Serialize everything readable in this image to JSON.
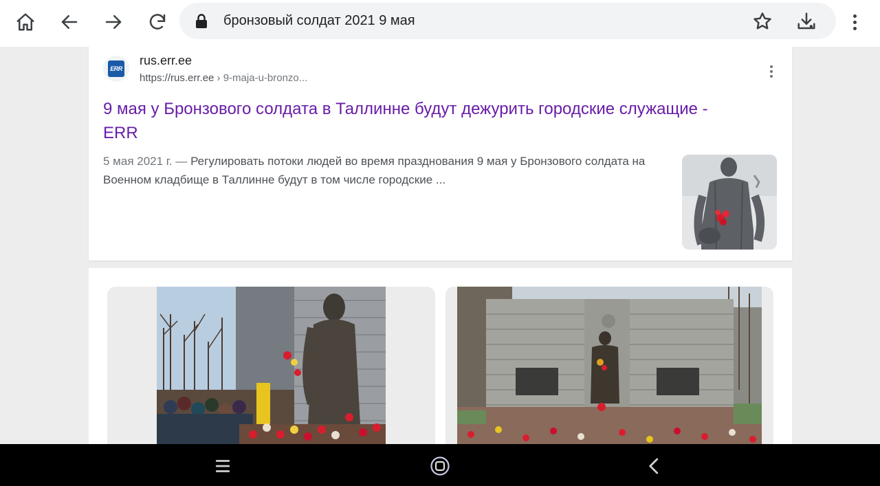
{
  "browser": {
    "url_text": "бронзовый солдат 2021 9 мая",
    "icons": [
      "home-icon",
      "back-icon",
      "forward-icon",
      "reload-icon",
      "lock-icon",
      "star-icon",
      "download-icon",
      "more-vert-icon"
    ]
  },
  "result": {
    "favicon_text": "ERR",
    "site_name": "rus.err.ee",
    "url": "https://rus.err.ee",
    "breadcrumb": " › 9-maja-u-bronzo...",
    "title": "9 мая у Бронзового солдата в Таллинне будут дежурить городские служащие - ERR",
    "date": "5 мая 2021 г. — ",
    "snippet": "Регулировать потоки людей во время празднования 9 мая у Бронзового солдата на Военном кладбище в Таллинне будут в том числе городские ..."
  },
  "image_results": {
    "tiles": [
      "bronze-soldier-photo-1",
      "bronze-soldier-photo-2"
    ]
  },
  "colors": {
    "visited_link": "#681da8",
    "snippet_text": "#4d5156",
    "nav_bar": "#000000"
  }
}
